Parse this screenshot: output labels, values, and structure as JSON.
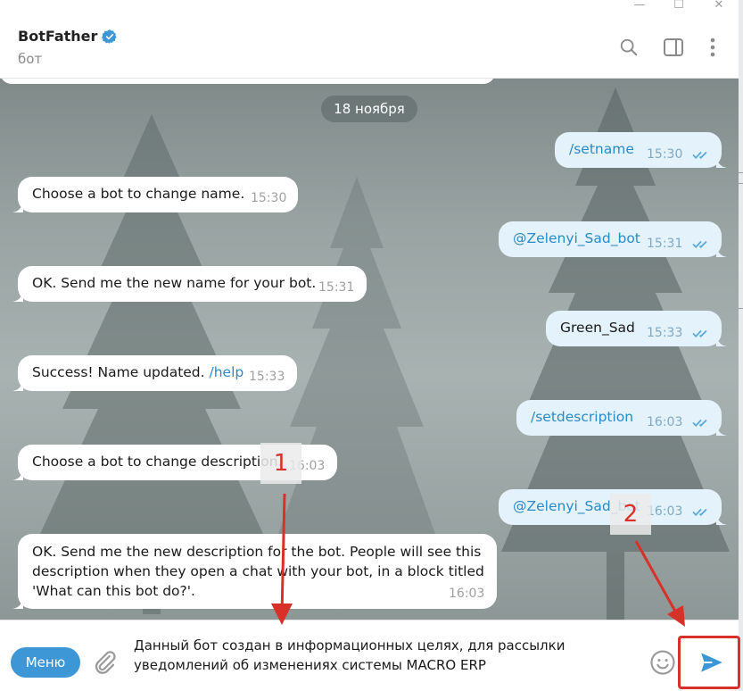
{
  "window": {
    "minimize": "—",
    "maximize": "☐",
    "close": "✕"
  },
  "header": {
    "name": "BotFather",
    "subtitle": "бот",
    "verified_icon": "verified-badge-icon"
  },
  "date_separator": "18 ноября",
  "messages": [
    {
      "dir": "out",
      "text": "/setname",
      "time": "15:30",
      "is_command": true
    },
    {
      "dir": "in",
      "text": "Choose a bot to change name.",
      "time": "15:30"
    },
    {
      "dir": "out",
      "text": "@Zelenyi_Sad_bot",
      "time": "15:31",
      "is_command": true
    },
    {
      "dir": "in",
      "text": "OK. Send me the new name for your bot.",
      "time": "15:31"
    },
    {
      "dir": "out",
      "text": "Green_Sad",
      "time": "15:33",
      "is_command": false
    },
    {
      "dir": "in",
      "text": "Success! Name updated.",
      "link": "/help",
      "time": "15:33"
    },
    {
      "dir": "out",
      "text": "/setdescription",
      "time": "16:03",
      "is_command": true
    },
    {
      "dir": "in",
      "text": "Choose a bot to change description.",
      "time": "16:03"
    },
    {
      "dir": "out",
      "text": "@Zelenyi_Sad_bot",
      "time": "16:03",
      "is_command": true
    },
    {
      "dir": "in",
      "lines": [
        "OK. Send me the new description for the bot. People will see this",
        "description when they open a chat with your bot, in a block titled",
        "'What can this bot do?'."
      ],
      "time": "16:03"
    }
  ],
  "composer": {
    "menu_label": "Меню",
    "input_lines": [
      "Данный бот создан в информационных целях, для рассылки",
      "уведомлений об изменениях системы MACRO ERP"
    ]
  },
  "annotations": {
    "label_1": "1",
    "label_2": "2"
  },
  "colors": {
    "accent": "#3d97d6",
    "link": "#2a8bc4",
    "outgoing_bubble": "#e3f2fb",
    "annotation_red": "#d8312a"
  }
}
